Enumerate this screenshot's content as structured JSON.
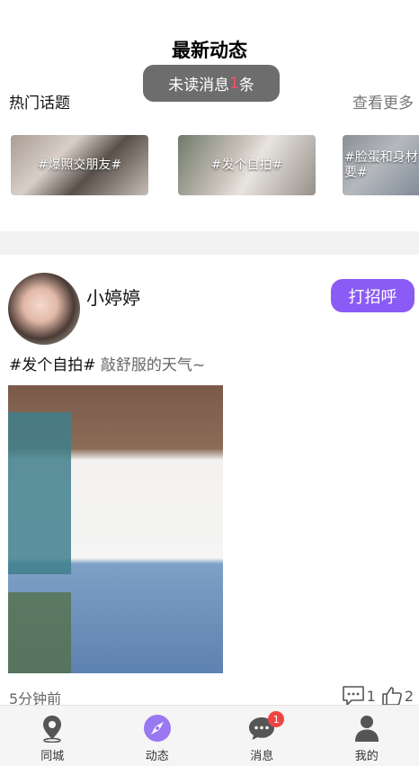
{
  "header": {
    "title": "最新动态"
  },
  "toast": {
    "prefix": "未读消息",
    "count": "1",
    "suffix": "条"
  },
  "hot_topics": {
    "title": "热门话题",
    "more": "查看更多",
    "items": [
      {
        "label": "#爆照交朋友#"
      },
      {
        "label": "#发个自拍#"
      },
      {
        "label": "#脸蛋和身材要#"
      }
    ]
  },
  "post": {
    "username": "小婷婷",
    "greet": "打招呼",
    "tag": "#发个自拍#",
    "text": "敲舒服的天气~",
    "time": "5分钟前",
    "comments": "1",
    "likes": "2"
  },
  "tabbar": {
    "items": [
      {
        "label": "同城",
        "icon": "location-pin-icon"
      },
      {
        "label": "动态",
        "icon": "compass-icon",
        "active": true
      },
      {
        "label": "消息",
        "icon": "chat-bubble-icon",
        "badge": "1"
      },
      {
        "label": "我的",
        "icon": "user-icon"
      }
    ]
  },
  "colors": {
    "accent": "#8a5cf5",
    "badge": "#f04444",
    "toast_bg": "#6d6d6d"
  }
}
